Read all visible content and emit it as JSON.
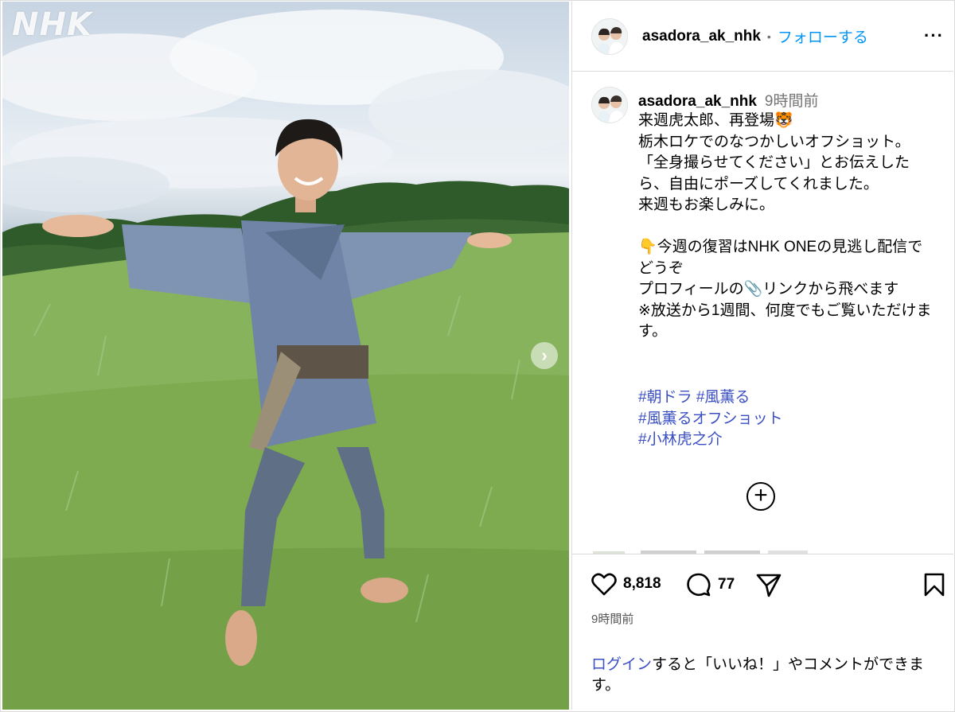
{
  "photo": {
    "watermark": "NHK",
    "next_icon": "chevron-right-icon"
  },
  "post": {
    "username": "asadora_ak_nhk",
    "dot": "•",
    "follow_label": "フォローする",
    "more_icon": "ellipsis-icon",
    "more_label": "···"
  },
  "caption": {
    "username": "asadora_ak_nhk",
    "time_ago": "9時間前",
    "text": "来週虎太郎、再登場🐯\n栃木ロケでのなつかしいオフショット。\n「全身撮らせてください」とお伝えしたら、自由にポーズしてくれました。\n来週もお楽しみに。\n\n👇今週の復習はNHK ONEの見逃し配信でどうぞ\nプロフィールの📎リンクから飛べます\n※放送から1週間、何度でもご覧いただけます。",
    "hashtags": [
      "#朝ドラ #風薫る",
      "#風薫るオフショット",
      "#小林虎之介"
    ],
    "load_more_icon": "plus-circle-icon",
    "load_more_label": "+"
  },
  "actions": {
    "likes": "8,818",
    "comments": "77",
    "timestamp": "9時間前"
  },
  "login_prompt": {
    "link": "ログイン",
    "text": "すると「いいね！」やコメントができます。"
  }
}
